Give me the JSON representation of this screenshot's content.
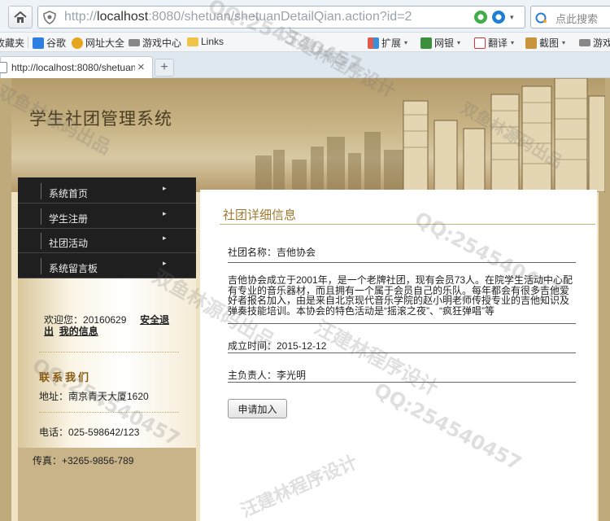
{
  "browser": {
    "url_prefix": "http://",
    "url_host": "localhost",
    "url_rest": ":8080/shetuan/shetuanDetailQian.action?id=2",
    "search_placeholder": "点此搜索",
    "bookmarks": [
      {
        "label": "收藏夹",
        "icon": "star-icon"
      },
      {
        "label": "谷歌",
        "icon": "google-icon"
      },
      {
        "label": "网址大全",
        "icon": "globe-icon"
      },
      {
        "label": "游戏中心",
        "icon": "gamepad-icon"
      },
      {
        "label": "Links",
        "icon": "folder-icon"
      }
    ],
    "toolbar_right": [
      {
        "label": "扩展",
        "icon": "grid-icon"
      },
      {
        "label": "网银",
        "icon": "shield-icon"
      },
      {
        "label": "翻译",
        "icon": "translate-icon"
      },
      {
        "label": "截图",
        "icon": "scissors-icon"
      },
      {
        "label": "游戏",
        "icon": "gamepad-icon"
      }
    ],
    "tab_title": "http://localhost:8080/shetuan",
    "tab_close": "×",
    "new_tab": "+"
  },
  "site": {
    "title": "学生社团管理系统"
  },
  "nav": {
    "items": [
      {
        "label": "系统首页"
      },
      {
        "label": "学生注册"
      },
      {
        "label": "社团活动"
      },
      {
        "label": "系统留言板"
      }
    ],
    "arrow": "▸"
  },
  "user": {
    "welcome_prefix": "欢迎您：",
    "username": "20160629",
    "logout_label": "安全退出",
    "my_info_label": "我的信息"
  },
  "contact": {
    "title": "联系我们",
    "address": "地址：南京青天大厦1620",
    "phone": "电话：025-598642/123",
    "fax": "传真：+3265-9856-789"
  },
  "detail": {
    "heading": "社团详细信息",
    "name_row": "社团名称：吉他协会",
    "intro": "吉他协会成立于2001年，是一个老牌社团，现有会员73人。在院学生活动中心配有专业的音乐器材，而且拥有一个属于会员自己的乐队。每年都会有很多吉他爱好者报名加入，由是来自北京现代音乐学院的赵小明老师传授专业的吉他知识及弹奏技能培训。本协会的特色活动是“摇滚之夜”、“疯狂弹唱”等",
    "founded_row": "成立时间：2015-12-12",
    "leader_row": "主负责人：李光明",
    "join_button": "申请加入"
  },
  "watermarks": [
    "汪建林程序设计",
    "双鱼林源码出品",
    "QQ:254540457",
    "QQ:254540457",
    "汪建林程序设计",
    "双鱼林源码出品",
    "QQ:254540457",
    "汪建林程序设计",
    "双鱼林源码出品",
    "QQ:254540457"
  ]
}
